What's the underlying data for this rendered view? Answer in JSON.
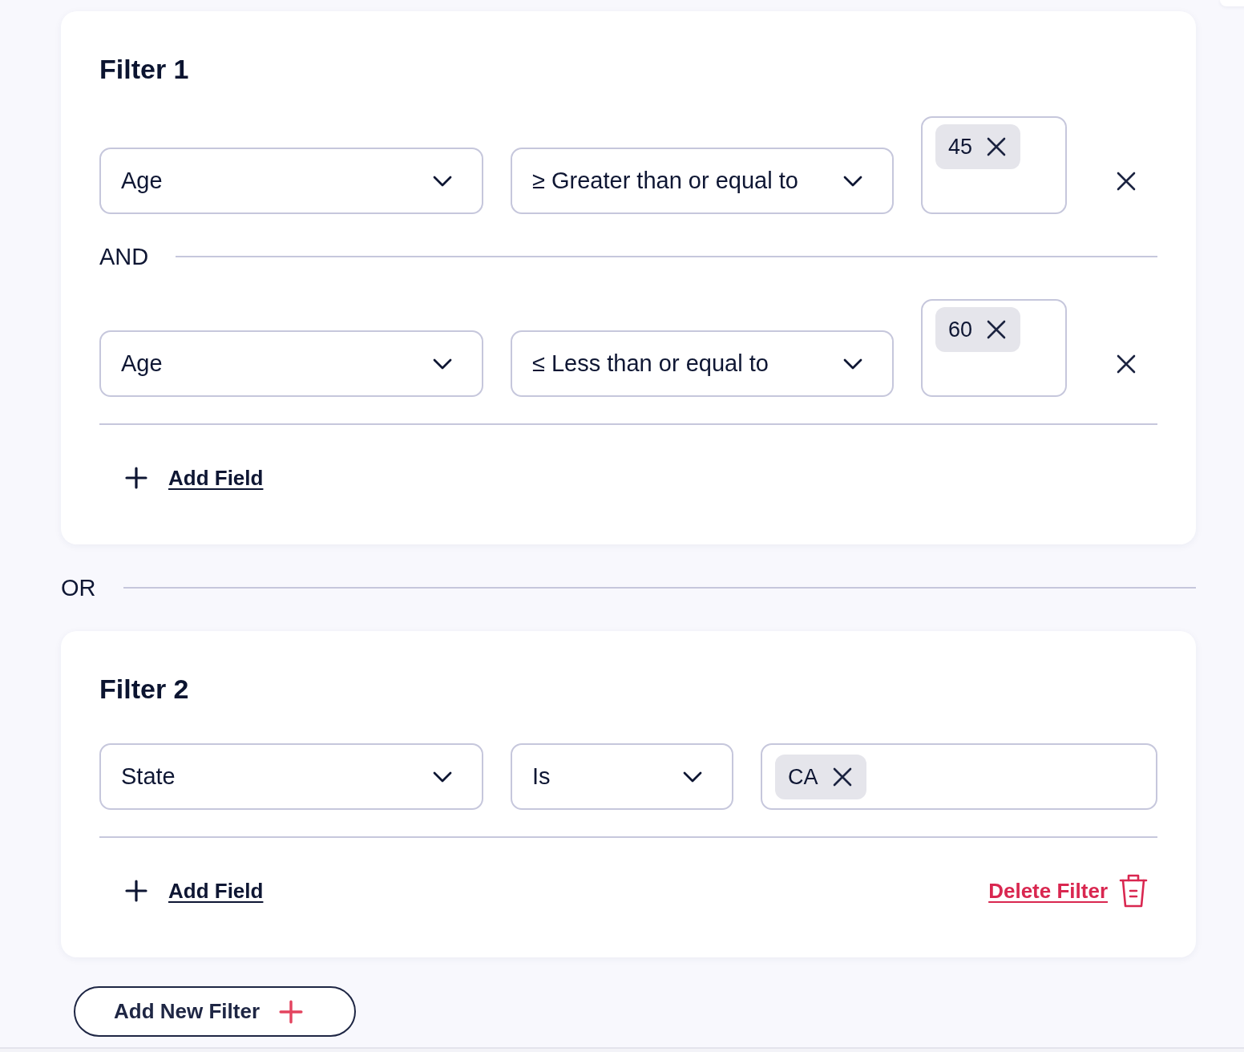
{
  "filters": [
    {
      "title": "Filter 1",
      "conditions": [
        {
          "field": "Age",
          "operator": "≥ Greater than or equal to",
          "values": [
            "45"
          ],
          "removable": true
        },
        {
          "field": "Age",
          "operator": "≤ Less than or equal to",
          "values": [
            "60"
          ],
          "removable": true
        }
      ],
      "condition_joiner": "AND",
      "add_field_link": "Add Field"
    },
    {
      "title": "Filter 2",
      "conditions": [
        {
          "field": "State",
          "operator": "Is",
          "values": [
            "CA"
          ],
          "removable": false
        }
      ],
      "add_field_link": "Add Field",
      "delete_filter_link": "Delete Filter"
    }
  ],
  "filter_joiner": "OR",
  "add_filter_button": "Add New Filter"
}
